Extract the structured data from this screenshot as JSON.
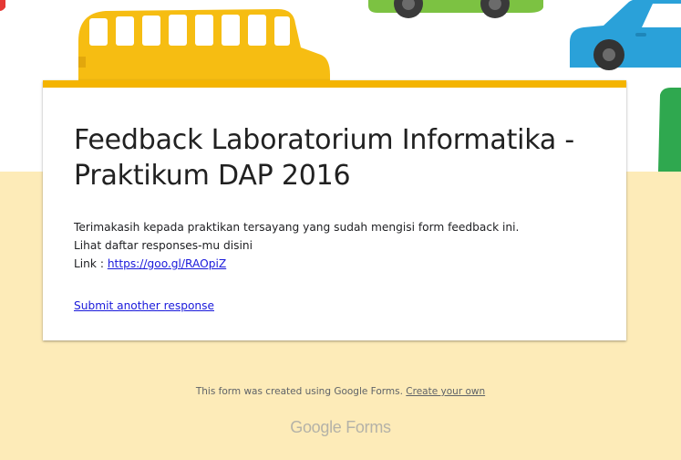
{
  "theme": {
    "accent_color": "#f4b400",
    "background_color": "#fdebb8",
    "link_color": "#1a1adb"
  },
  "form": {
    "title": "Feedback Laboratorium Informatika - Praktikum DAP 2016",
    "confirmation_lines": [
      "Terimakasih kepada praktikan tersayang yang sudah mengisi form feedback ini.",
      "Lihat daftar responses-mu disini"
    ],
    "link_prefix": "Link : ",
    "link_text": "https://goo.gl/RAOpiZ",
    "submit_another_label": "Submit another response"
  },
  "footer": {
    "note": "This form was created using Google Forms.",
    "create_link_label": "Create your own",
    "brand_google": "Google",
    "brand_forms": "Forms"
  },
  "banner": {
    "illustration": "vehicles-illustration"
  }
}
